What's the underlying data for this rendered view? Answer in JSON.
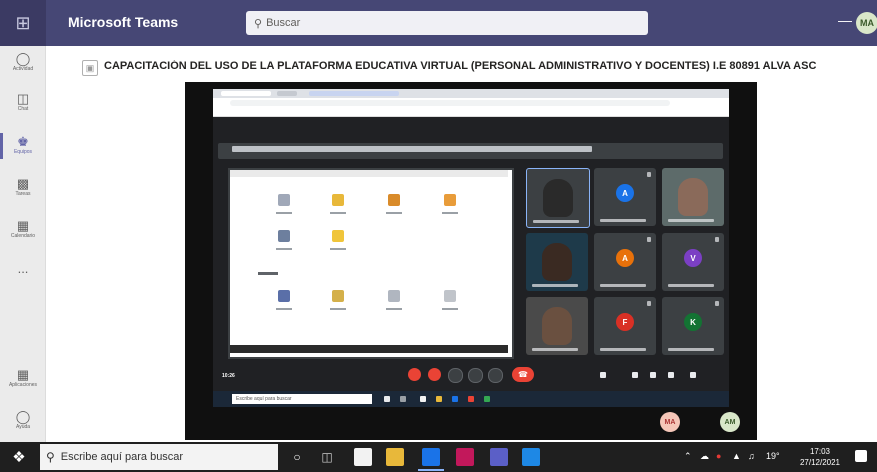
{
  "app": {
    "title": "Microsoft Teams",
    "search_placeholder": "Buscar",
    "user_initials": "MA"
  },
  "rail": [
    {
      "label": "Actividad",
      "icon": "bell-icon"
    },
    {
      "label": "Chat",
      "icon": "chat-icon"
    },
    {
      "label": "Equipos",
      "icon": "teams-icon",
      "active": true
    },
    {
      "label": "Tareas",
      "icon": "backpack-icon"
    },
    {
      "label": "Calendario",
      "icon": "calendar-icon"
    },
    {
      "label": "...",
      "icon": "more-icon"
    },
    {
      "label": "Aplicaciones",
      "icon": "apps-icon"
    },
    {
      "label": "Ayuda",
      "icon": "help-icon"
    }
  ],
  "meeting": {
    "title": "CAPACITACIÓN DEL USO DE LA PLATAFORMA EDUCATIVA VIRTUAL (PERSONAL ADMINISTRATIVO Y DOCENTES) I.E 80891 ALVA ASC"
  },
  "shared_screen": {
    "time": "10:26",
    "participant_initials": [
      "A",
      "A",
      "V",
      "F",
      "K"
    ],
    "self_initials": [
      "MA",
      "AM"
    ]
  },
  "taskbar": {
    "search_placeholder": "Escribe aquí para buscar",
    "time": "17:03",
    "date": "27/12/2021",
    "tray_temp": "19°"
  },
  "colors": {
    "teams_header": "#464775",
    "teams_accent": "#6264a7",
    "meet_background": "#202124",
    "leave_red": "#ea4335"
  }
}
